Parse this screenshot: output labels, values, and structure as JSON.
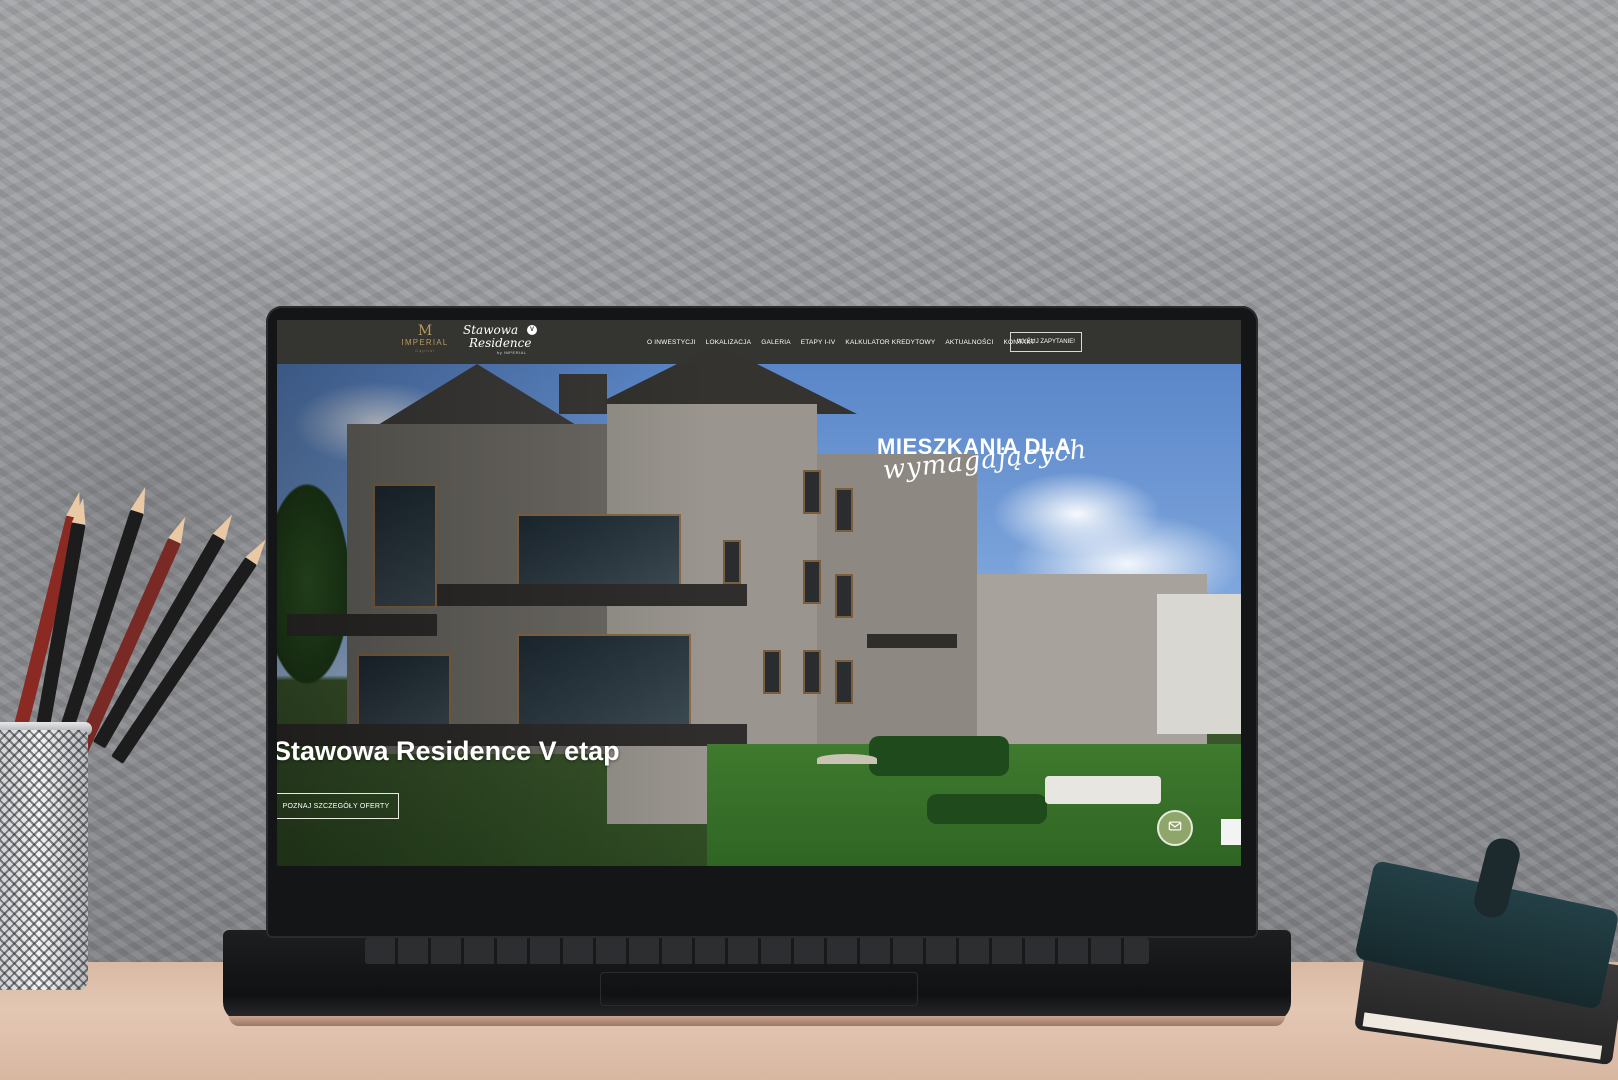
{
  "site": {
    "logos": {
      "imperial_mark": "M",
      "imperial_word": "IMPERIAL",
      "imperial_sub": "Capital",
      "stawowa_line1": "Stawowa",
      "stawowa_line2": "Residence",
      "stawowa_badge": "V",
      "stawowa_by": "by IMPERIAL"
    },
    "menu": [
      {
        "label": "O INWESTYCJI"
      },
      {
        "label": "LOKALIZACJA"
      },
      {
        "label": "GALERIA"
      },
      {
        "label": "ETAPY I-IV"
      },
      {
        "label": "KALKULATOR KREDYTOWY"
      },
      {
        "label": "AKTUALNOŚCI"
      },
      {
        "label": "KONTAKT"
      }
    ],
    "cta_top": "WYŚLIJ ZAPYTANIE!",
    "hero": {
      "tagline_line1": "MIESZKANIA DLA",
      "tagline_line2": "wymagających",
      "title": "Stawowa Residence V etap",
      "cta": "POZNAJ SZCZEGÓŁY OFERTY"
    },
    "icons": {
      "mail": "mail-icon"
    },
    "colors": {
      "nav_bg": "#343431",
      "accent_gold": "#b89a5c",
      "fab_green": "#8fa66a"
    }
  }
}
